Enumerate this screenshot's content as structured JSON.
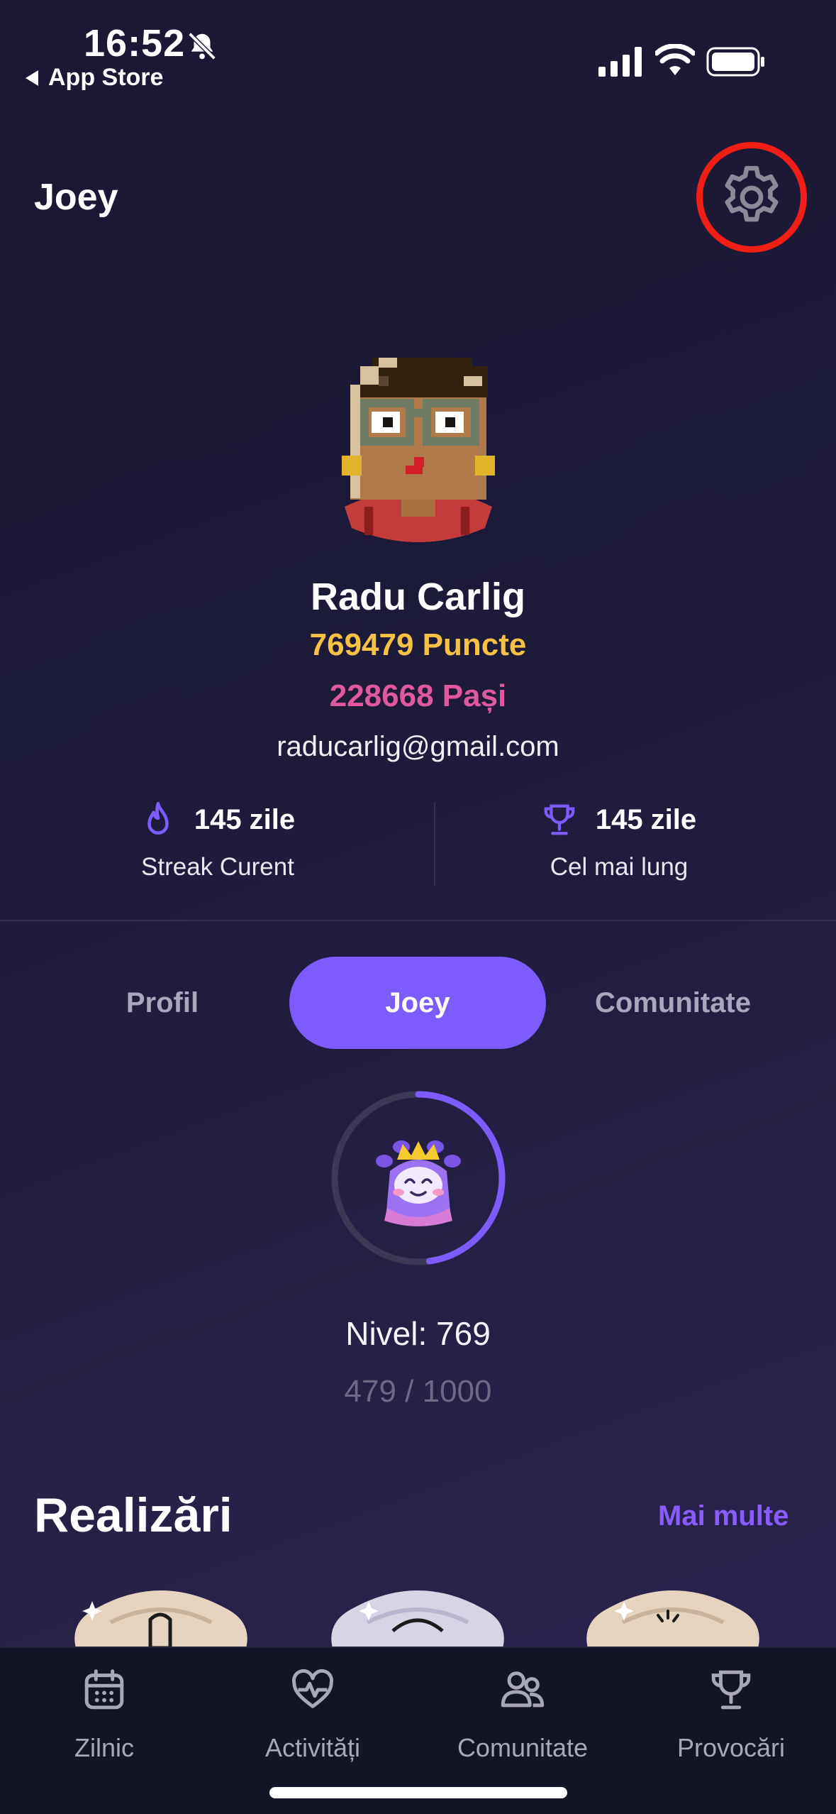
{
  "status_bar": {
    "time": "16:52",
    "back_label": "App Store",
    "icons": [
      "bell-muted-icon",
      "cellular-signal-icon",
      "wifi-icon",
      "battery-icon"
    ]
  },
  "header": {
    "title": "Joey",
    "settings_icon": "gear-icon"
  },
  "profile": {
    "name": "Radu Carlig",
    "points": "769479 Puncte",
    "steps": "228668 Pași",
    "email": "raducarlig@gmail.com"
  },
  "stats": {
    "current": {
      "value": "145 zile",
      "label": "Streak Curent",
      "icon": "flame-icon"
    },
    "longest": {
      "value": "145 zile",
      "label": "Cel mai lung",
      "icon": "trophy-icon"
    }
  },
  "tabs": [
    {
      "label": "Profil",
      "active": false
    },
    {
      "label": "Joey",
      "active": true
    },
    {
      "label": "Comunitate",
      "active": false
    }
  ],
  "level": {
    "text": "Nivel: 769",
    "progress_text": "479 / 1000",
    "progress_fraction": 0.479
  },
  "achievements": {
    "title": "Realizări",
    "more_label": "Mai multe"
  },
  "bottom_nav": [
    {
      "label": "Zilnic",
      "icon": "calendar-icon"
    },
    {
      "label": "Activități",
      "icon": "heart-pulse-icon"
    },
    {
      "label": "Comunitate",
      "icon": "users-icon"
    },
    {
      "label": "Provocări",
      "icon": "trophy-icon"
    }
  ],
  "colors": {
    "accent": "#7d5bff",
    "points": "#f5c243",
    "steps": "#e0599e",
    "highlight_ring": "#f01e14"
  }
}
